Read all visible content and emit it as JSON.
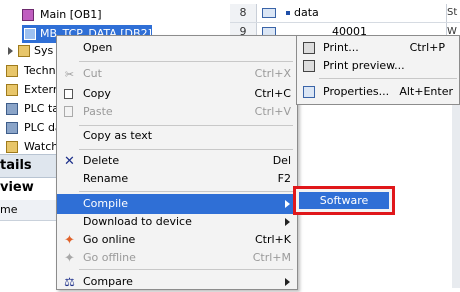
{
  "tree": {
    "items": [
      {
        "label": "Main [OB1]",
        "icon": "block-icon"
      },
      {
        "label": "MB_TCP_DATA [DB2]",
        "icon": "data-block-icon"
      },
      {
        "label": "Sys",
        "icon": "folder-icon"
      },
      {
        "label": "Techn",
        "icon": "folder-icon"
      },
      {
        "label": "Extern",
        "icon": "folder-icon"
      },
      {
        "label": "PLC ta",
        "icon": "folder-icon"
      },
      {
        "label": "PLC da",
        "icon": "folder-icon"
      },
      {
        "label": "Watch",
        "icon": "folder-icon"
      }
    ],
    "details_view_label": "tails view",
    "name_column": "me"
  },
  "editor": {
    "rows": [
      {
        "num": "8",
        "name": "data",
        "value": "",
        "side": "St"
      },
      {
        "num": "9",
        "name": "",
        "value": "40001",
        "side": "W"
      }
    ],
    "extra_side": [
      "P",
      "P"
    ]
  },
  "context_menu": {
    "items": [
      {
        "label": "Open",
        "shortcut": "",
        "icon": "",
        "disabled": false
      },
      {
        "label": "Cut",
        "shortcut": "Ctrl+X",
        "icon": "cut-icon",
        "disabled": true
      },
      {
        "label": "Copy",
        "shortcut": "Ctrl+C",
        "icon": "copy-icon",
        "disabled": false
      },
      {
        "label": "Paste",
        "shortcut": "Ctrl+V",
        "icon": "paste-icon",
        "disabled": true
      },
      {
        "label": "Copy as text",
        "shortcut": "",
        "icon": "",
        "disabled": false
      },
      {
        "label": "Delete",
        "shortcut": "Del",
        "icon": "delete-icon",
        "disabled": false
      },
      {
        "label": "Rename",
        "shortcut": "F2",
        "icon": "",
        "disabled": false
      },
      {
        "label": "Compile",
        "shortcut": "",
        "icon": "",
        "disabled": false,
        "submenu": true,
        "highlighted": true
      },
      {
        "label": "Download to device",
        "shortcut": "",
        "icon": "",
        "disabled": false,
        "submenu": true
      },
      {
        "label": "Go online",
        "shortcut": "Ctrl+K",
        "icon": "go-online-icon",
        "disabled": false
      },
      {
        "label": "Go offline",
        "shortcut": "Ctrl+M",
        "icon": "go-offline-icon",
        "disabled": true
      },
      {
        "label": "Compare",
        "shortcut": "",
        "icon": "compare-icon",
        "disabled": false,
        "submenu": true
      }
    ]
  },
  "print_submenu": {
    "items": [
      {
        "label": "Print...",
        "shortcut": "Ctrl+P",
        "icon": "print-icon"
      },
      {
        "label": "Print preview...",
        "shortcut": "",
        "icon": "print-preview-icon"
      },
      {
        "label": "Properties...",
        "shortcut": "Alt+Enter",
        "icon": "properties-icon"
      }
    ]
  },
  "compile_submenu": {
    "items": [
      {
        "label": "Software"
      }
    ]
  },
  "colors": {
    "highlight": "#2f6fd6",
    "annotation_border": "#e0171a"
  }
}
